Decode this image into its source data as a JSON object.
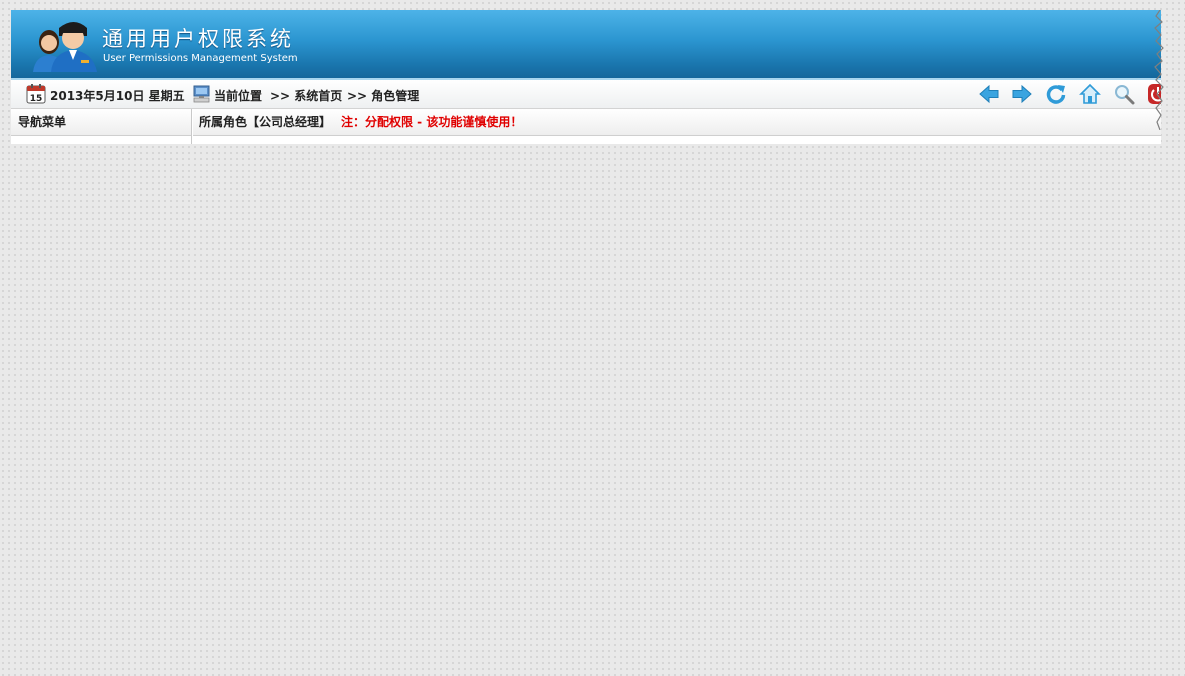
{
  "header": {
    "title": "通用用户权限系统",
    "subtitle": "User Permissions Management System"
  },
  "navbar": {
    "calendar_day": "15",
    "date": "2013年5月10日 星期五",
    "location_label": "当前位置",
    "breadcrumb": [
      ">> 系统首页",
      ">> 角色管理"
    ],
    "tools": [
      "back-icon",
      "forward-icon",
      "refresh-icon",
      "home-icon",
      "search-icon",
      "power-icon"
    ]
  },
  "sidebar": {
    "title": "导航菜单"
  },
  "main": {
    "role_title": "所属角色【公司总经理】",
    "note": "注：分配权限 - 该功能谨慎使用！"
  },
  "colors": {
    "header_blue": "#2b95d0",
    "note_red": "#e00000",
    "icon_blue": "#3aa4e0"
  }
}
